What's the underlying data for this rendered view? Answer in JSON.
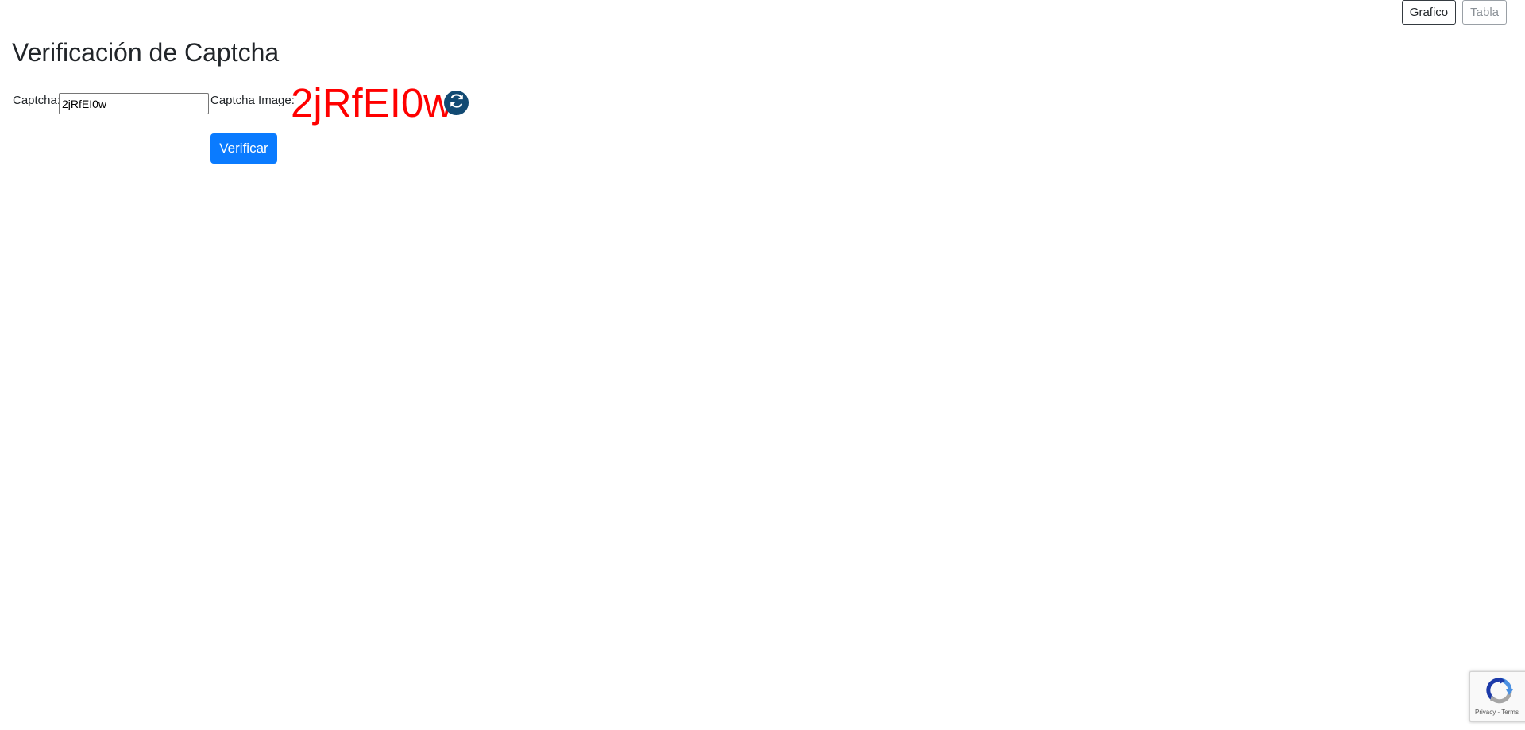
{
  "view_toggle": {
    "chart_label": "Grafico",
    "table_label": "Tabla"
  },
  "page_title": "Verificación de Captcha",
  "form": {
    "captcha_label": "Captcha:",
    "captcha_value": "2jRfEI0w",
    "captcha_image_label": "Captcha Image:",
    "captcha_image_text": "2jRfEI0w",
    "captcha_image_color": "#ff0000",
    "refresh_icon": "refresh-icon",
    "verify_label": "Verificar"
  },
  "recaptcha": {
    "terms_text": "Privacy - Terms",
    "icon": "recaptcha-icon"
  },
  "colors": {
    "primary_button": "#0a7bff",
    "refresh_button": "#124a73"
  }
}
